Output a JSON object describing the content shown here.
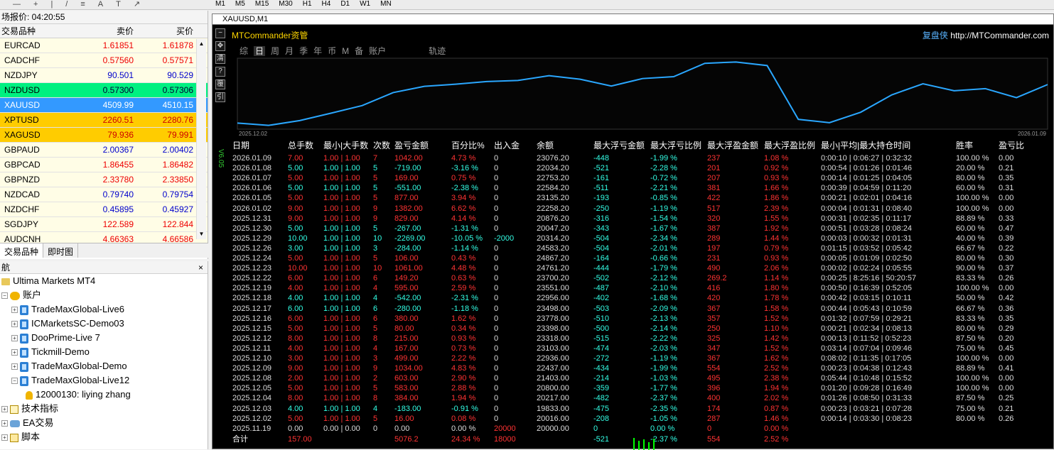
{
  "market_watch": {
    "title": "场报价: 04:20:55",
    "col_symbol": "交易品种",
    "col_bid": "卖价",
    "col_ask": "买价",
    "rows": [
      {
        "symbol": "EURCAD",
        "bid": "1.61851",
        "ask": "1.61878"
      },
      {
        "symbol": "CADCHF",
        "bid": "0.57560",
        "ask": "0.57571"
      },
      {
        "symbol": "NZDJPY",
        "bid": "90.501",
        "ask": "90.529"
      },
      {
        "symbol": "NZDUSD",
        "bid": "0.57300",
        "ask": "0.57306"
      },
      {
        "symbol": "XAUUSD",
        "bid": "4509.99",
        "ask": "4510.15"
      },
      {
        "symbol": "XPTUSD",
        "bid": "2260.51",
        "ask": "2280.76"
      },
      {
        "symbol": "XAGUSD",
        "bid": "79.936",
        "ask": "79.991"
      },
      {
        "symbol": "GBPAUD",
        "bid": "2.00367",
        "ask": "2.00402"
      },
      {
        "symbol": "GBPCAD",
        "bid": "1.86455",
        "ask": "1.86482"
      },
      {
        "symbol": "GBPNZD",
        "bid": "2.33780",
        "ask": "2.33850"
      },
      {
        "symbol": "NZDCAD",
        "bid": "0.79740",
        "ask": "0.79754"
      },
      {
        "symbol": "NZDCHF",
        "bid": "0.45895",
        "ask": "0.45927"
      },
      {
        "symbol": "SGDJPY",
        "bid": "122.589",
        "ask": "122.844"
      },
      {
        "symbol": "AUDCNH",
        "bid": "4.66363",
        "ask": "4.66586"
      }
    ],
    "tab_symbols": "交易品种",
    "tab_ticks": "即时图"
  },
  "timeframes": [
    "M1",
    "M5",
    "M15",
    "M30",
    "H1",
    "H4",
    "D1",
    "W1",
    "MN"
  ],
  "navigator": {
    "title": "航",
    "broker": "Ultima Markets MT4",
    "accounts_label": "账户",
    "accounts": [
      "TradeMaxGlobal-Live6",
      "ICMarketsSC-Demo03",
      "DooPrime-Live 7",
      "Tickmill-Demo",
      "TradeMaxGlobal-Demo",
      "TradeMaxGlobal-Live12"
    ],
    "login": "12000130: liying zhang",
    "indicators": "技术指标",
    "ea": "EA交易",
    "scripts": "脚本"
  },
  "chart": {
    "window_title": "XAUUSD,M1",
    "panel_title": "MTCommander资管",
    "brand": "复盘侠",
    "url": "http://MTCommander.com",
    "periods": [
      "综",
      "日",
      "周",
      "月",
      "季",
      "年",
      "币",
      "M",
      "备",
      "账户"
    ],
    "active_period": "日",
    "trajectory": "轨迹",
    "date_start": "2025.12.02",
    "date_end": "2026.01.09",
    "side_buttons": [
      "−",
      "✥",
      "清",
      "?",
      "覆",
      "引"
    ],
    "vertical_label": "V6.05",
    "equity": [
      20016,
      19833,
      20217,
      20800,
      21403,
      22437,
      22936,
      23103,
      23318,
      23398,
      23778,
      23498,
      22956,
      23551,
      23700,
      24761,
      24867,
      24583,
      20314,
      20047,
      20876,
      22258,
      23135,
      22584,
      22753,
      22034,
      23076
    ]
  },
  "table": {
    "headers": [
      "日期",
      "总手数",
      "最小|大手数",
      "次数",
      "盈亏金额",
      "百分比%",
      "出入金",
      "余额",
      "最大浮亏金额",
      "最大浮亏比例",
      "最大浮盈金额",
      "最大浮盈比例",
      "最小|平均|最大持仓时间",
      "胜率",
      "盈亏比"
    ],
    "rows": [
      [
        "2026.01.09",
        "7.00",
        "1.00 | 1.00",
        "7",
        "1042.00",
        "4.73 %",
        "0",
        "23076.20",
        "-448",
        "-1.99 %",
        "237",
        "1.08 %",
        "0:00:10 | 0:06:27 | 0:32:32",
        "100.00 %",
        "0.00"
      ],
      [
        "2026.01.08",
        "5.00",
        "1.00 | 1.00",
        "5",
        "-719.00",
        "-3.16 %",
        "0",
        "22034.20",
        "-521",
        "-2.28 %",
        "201",
        "0.92 %",
        "0:00:54 | 0:01:26 | 0:01:46",
        "20.00 %",
        "0.21"
      ],
      [
        "2026.01.07",
        "5.00",
        "1.00 | 1.00",
        "5",
        "169.00",
        "0.75 %",
        "0",
        "22753.20",
        "-161",
        "-0.72 %",
        "207",
        "0.93 %",
        "0:00:14 | 0:01:25 | 0:04:05",
        "80.00 %",
        "0.35"
      ],
      [
        "2026.01.06",
        "5.00",
        "1.00 | 1.00",
        "5",
        "-551.00",
        "-2.38 %",
        "0",
        "22584.20",
        "-511",
        "-2.21 %",
        "381",
        "1.66 %",
        "0:00:39 | 0:04:59 | 0:11:20",
        "60.00 %",
        "0.31"
      ],
      [
        "2026.01.05",
        "5.00",
        "1.00 | 1.00",
        "5",
        "877.00",
        "3.94 %",
        "0",
        "23135.20",
        "-193",
        "-0.85 %",
        "422",
        "1.86 %",
        "0:00:21 | 0:02:01 | 0:04:16",
        "100.00 %",
        "0.00"
      ],
      [
        "2026.01.02",
        "9.00",
        "1.00 | 1.00",
        "9",
        "1382.00",
        "6.62 %",
        "0",
        "22258.20",
        "-250",
        "-1.19 %",
        "517",
        "2.39 %",
        "0:00:04 | 0:01:31 | 0:08:40",
        "100.00 %",
        "0.00"
      ],
      [
        "2025.12.31",
        "9.00",
        "1.00 | 1.00",
        "9",
        "829.00",
        "4.14 %",
        "0",
        "20876.20",
        "-316",
        "-1.54 %",
        "320",
        "1.55 %",
        "0:00:31 | 0:02:35 | 0:11:17",
        "88.89 %",
        "0.33"
      ],
      [
        "2025.12.30",
        "5.00",
        "1.00 | 1.00",
        "5",
        "-267.00",
        "-1.31 %",
        "0",
        "20047.20",
        "-343",
        "-1.67 %",
        "387",
        "1.92 %",
        "0:00:51 | 0:03:28 | 0:08:24",
        "60.00 %",
        "0.47"
      ],
      [
        "2025.12.29",
        "10.00",
        "1.00 | 1.00",
        "10",
        "-2269.00",
        "-10.05 %",
        "-2000",
        "20314.20",
        "-504",
        "-2.34 %",
        "289",
        "1.44 %",
        "0:00:03 | 0:00:32 | 0:01:31",
        "40.00 %",
        "0.39"
      ],
      [
        "2025.12.26",
        "3.00",
        "1.00 | 1.00",
        "3",
        "-284.00",
        "-1.14 %",
        "0",
        "24583.20",
        "-504",
        "-2.01 %",
        "197",
        "0.79 %",
        "0:01:15 | 0:03:52 | 0:05:42",
        "66.67 %",
        "0.22"
      ],
      [
        "2025.12.24",
        "5.00",
        "1.00 | 1.00",
        "5",
        "106.00",
        "0.43 %",
        "0",
        "24867.20",
        "-164",
        "-0.66 %",
        "231",
        "0.93 %",
        "0:00:05 | 0:01:09 | 0:02:50",
        "80.00 %",
        "0.30"
      ],
      [
        "2025.12.23",
        "10.00",
        "1.00 | 1.00",
        "10",
        "1061.00",
        "4.48 %",
        "0",
        "24761.20",
        "-444",
        "-1.79 %",
        "490",
        "2.06 %",
        "0:00:02 | 0:02:24 | 0:05:55",
        "90.00 %",
        "0.37"
      ],
      [
        "2025.12.22",
        "6.00",
        "1.00 | 1.00",
        "6",
        "149.20",
        "0.63 %",
        "0",
        "23700.20",
        "-502",
        "-2.12 %",
        "269.2",
        "1.14 %",
        "0:00:25 | 8:25:16 | 50:20:57",
        "83.33 %",
        "0.26"
      ],
      [
        "2025.12.19",
        "4.00",
        "1.00 | 1.00",
        "4",
        "595.00",
        "2.59 %",
        "0",
        "23551.00",
        "-487",
        "-2.10 %",
        "416",
        "1.80 %",
        "0:00:50 | 0:16:39 | 0:52:05",
        "100.00 %",
        "0.00"
      ],
      [
        "2025.12.18",
        "4.00",
        "1.00 | 1.00",
        "4",
        "-542.00",
        "-2.31 %",
        "0",
        "22956.00",
        "-402",
        "-1.68 %",
        "420",
        "1.78 %",
        "0:00:42 | 0:03:15 | 0:10:11",
        "50.00 %",
        "0.42"
      ],
      [
        "2025.12.17",
        "6.00",
        "1.00 | 1.00",
        "6",
        "-280.00",
        "-1.18 %",
        "0",
        "23498.00",
        "-503",
        "-2.09 %",
        "367",
        "1.58 %",
        "0:00:44 | 0:05:43 | 0:10:59",
        "66.67 %",
        "0.36"
      ],
      [
        "2025.12.16",
        "6.00",
        "1.00 | 1.00",
        "6",
        "380.00",
        "1.62 %",
        "0",
        "23778.00",
        "-510",
        "-2.13 %",
        "357",
        "1.52 %",
        "0:01:32 | 0:07:59 | 0:29:21",
        "83.33 %",
        "0.35"
      ],
      [
        "2025.12.15",
        "5.00",
        "1.00 | 1.00",
        "5",
        "80.00",
        "0.34 %",
        "0",
        "23398.00",
        "-500",
        "-2.14 %",
        "250",
        "1.10 %",
        "0:00:21 | 0:02:34 | 0:08:13",
        "80.00 %",
        "0.29"
      ],
      [
        "2025.12.12",
        "8.00",
        "1.00 | 1.00",
        "8",
        "215.00",
        "0.93 %",
        "0",
        "23318.00",
        "-515",
        "-2.22 %",
        "325",
        "1.42 %",
        "0:00:13 | 0:11:52 | 0:52:23",
        "87.50 %",
        "0.20"
      ],
      [
        "2025.12.11",
        "4.00",
        "1.00 | 1.00",
        "4",
        "167.00",
        "0.73 %",
        "0",
        "23103.00",
        "-474",
        "-2.03 %",
        "347",
        "1.52 %",
        "0:03:14 | 0:07:04 | 0:09:46",
        "75.00 %",
        "0.45"
      ],
      [
        "2025.12.10",
        "3.00",
        "1.00 | 1.00",
        "3",
        "499.00",
        "2.22 %",
        "0",
        "22936.00",
        "-272",
        "-1.19 %",
        "367",
        "1.62 %",
        "0:08:02 | 0:11:35 | 0:17:05",
        "100.00 %",
        "0.00"
      ],
      [
        "2025.12.09",
        "9.00",
        "1.00 | 1.00",
        "9",
        "1034.00",
        "4.83 %",
        "0",
        "22437.00",
        "-434",
        "-1.99 %",
        "554",
        "2.52 %",
        "0:00:23 | 0:04:38 | 0:12:43",
        "88.89 %",
        "0.41"
      ],
      [
        "2025.12.08",
        "2.00",
        "1.00 | 1.00",
        "2",
        "603.00",
        "2.90 %",
        "0",
        "21403.00",
        "-214",
        "-1.03 %",
        "495",
        "2.38 %",
        "0:05:44 | 0:10:48 | 0:15:52",
        "100.00 %",
        "0.00"
      ],
      [
        "2025.12.05",
        "5.00",
        "1.00 | 1.00",
        "5",
        "583.00",
        "2.88 %",
        "0",
        "20800.00",
        "-359",
        "-1.77 %",
        "396",
        "1.94 %",
        "0:01:20 | 0:09:28 | 0:16:49",
        "100.00 %",
        "0.00"
      ],
      [
        "2025.12.04",
        "8.00",
        "1.00 | 1.00",
        "8",
        "384.00",
        "1.94 %",
        "0",
        "20217.00",
        "-482",
        "-2.37 %",
        "400",
        "2.02 %",
        "0:01:26 | 0:08:50 | 0:31:33",
        "87.50 %",
        "0.25"
      ],
      [
        "2025.12.03",
        "4.00",
        "1.00 | 1.00",
        "4",
        "-183.00",
        "-0.91 %",
        "0",
        "19833.00",
        "-475",
        "-2.35 %",
        "174",
        "0.87 %",
        "0:00:23 | 0:03:21 | 0:07:28",
        "75.00 %",
        "0.21"
      ],
      [
        "2025.12.02",
        "5.00",
        "1.00 | 1.00",
        "5",
        "16.00",
        "0.08 %",
        "0",
        "20016.00",
        "-208",
        "-1.05 %",
        "287",
        "1.46 %",
        "0:00:14 | 0:03:30 | 0:08:23",
        "80.00 %",
        "0.26"
      ],
      [
        "2025.11.19",
        "0.00",
        "0.00 | 0.00",
        "0",
        "0.00",
        "0.00 %",
        "20000",
        "20000.00",
        "0",
        "0.00 %",
        "0",
        "0.00 %",
        "",
        "",
        ""
      ]
    ],
    "total": [
      "合计",
      "157.00",
      "",
      "",
      "5076.2",
      "24.34 %",
      "18000",
      "",
      "-521",
      "-2.37 %",
      "554",
      "2.52 %",
      "",
      "",
      ""
    ]
  }
}
